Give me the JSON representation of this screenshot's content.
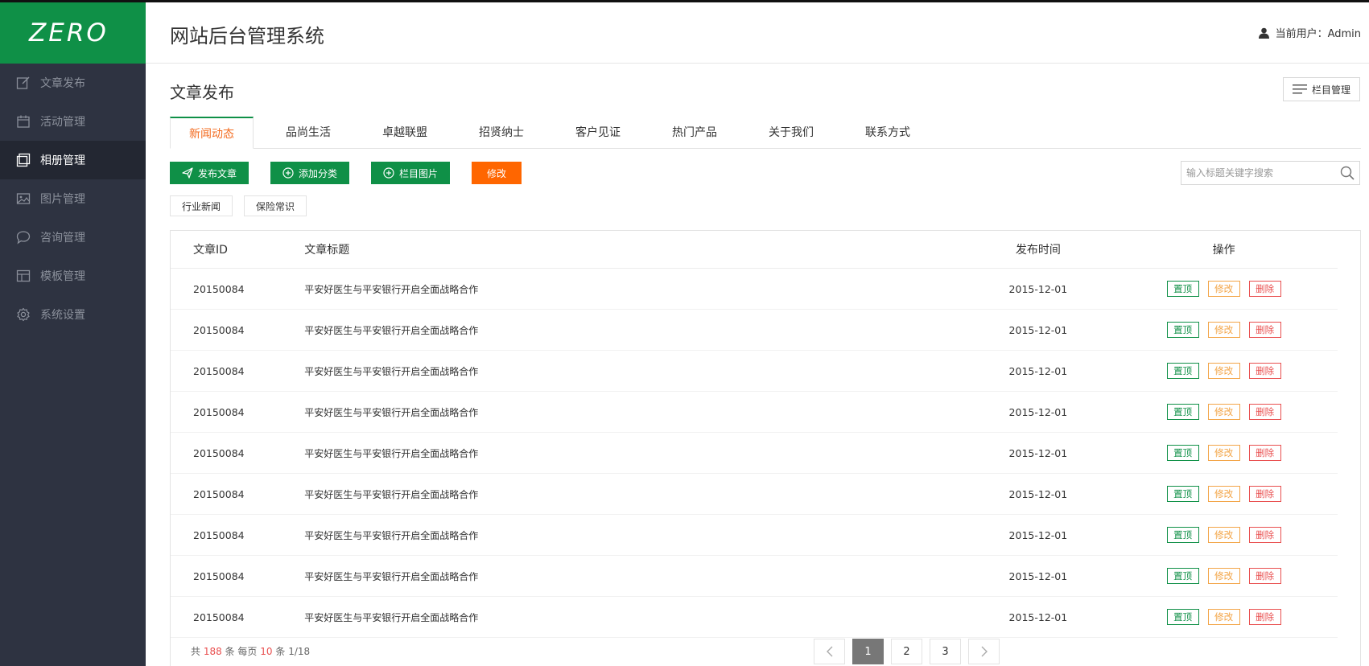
{
  "app": {
    "logo": "ZERO",
    "title": "网站后台管理系统"
  },
  "user": {
    "label": "当前用户：Admin"
  },
  "sidebar": {
    "items": [
      {
        "label": "文章发布",
        "icon": "edit-icon"
      },
      {
        "label": "活动管理",
        "icon": "calendar-icon"
      },
      {
        "label": "相册管理",
        "icon": "album-icon",
        "active": true
      },
      {
        "label": "图片管理",
        "icon": "image-icon"
      },
      {
        "label": "咨询管理",
        "icon": "chat-icon"
      },
      {
        "label": "模板管理",
        "icon": "template-icon"
      },
      {
        "label": "系统设置",
        "icon": "gear-icon"
      }
    ]
  },
  "page": {
    "title": "文章发布",
    "column_manage": "栏目管理"
  },
  "tabs": [
    "新闻动态",
    "品尚生活",
    "卓越联盟",
    "招贤纳士",
    "客户见证",
    "热门产品",
    "关于我们",
    "联系方式"
  ],
  "toolbar": {
    "publish": "发布文章",
    "add_category": "添加分类",
    "column_image": "栏目图片",
    "edit": "修改"
  },
  "search": {
    "placeholder": "输入标题关键字搜索"
  },
  "subcategories": [
    "行业新闻",
    "保险常识"
  ],
  "table": {
    "headers": {
      "id": "文章ID",
      "title": "文章标题",
      "time": "发布时间",
      "ops": "操作"
    },
    "ops": {
      "top": "置顶",
      "edit": "修改",
      "delete": "删除"
    },
    "rows": [
      {
        "id": "20150084",
        "title": "平安好医生与平安银行开启全面战略合作",
        "time": "2015-12-01"
      },
      {
        "id": "20150084",
        "title": "平安好医生与平安银行开启全面战略合作",
        "time": "2015-12-01"
      },
      {
        "id": "20150084",
        "title": "平安好医生与平安银行开启全面战略合作",
        "time": "2015-12-01"
      },
      {
        "id": "20150084",
        "title": "平安好医生与平安银行开启全面战略合作",
        "time": "2015-12-01"
      },
      {
        "id": "20150084",
        "title": "平安好医生与平安银行开启全面战略合作",
        "time": "2015-12-01"
      },
      {
        "id": "20150084",
        "title": "平安好医生与平安银行开启全面战略合作",
        "time": "2015-12-01"
      },
      {
        "id": "20150084",
        "title": "平安好医生与平安银行开启全面战略合作",
        "time": "2015-12-01"
      },
      {
        "id": "20150084",
        "title": "平安好医生与平安银行开启全面战略合作",
        "time": "2015-12-01"
      },
      {
        "id": "20150084",
        "title": "平安好医生与平安银行开启全面战略合作",
        "time": "2015-12-01"
      }
    ]
  },
  "pagination": {
    "total_prefix": "共",
    "total": "188",
    "total_suffix": "条 每页",
    "per_page": "10",
    "per_page_suffix": "条",
    "current_of": "1/18",
    "pages": [
      "1",
      "2",
      "3"
    ],
    "active_page": "1"
  },
  "colors": {
    "brand_green": "#0f9047",
    "accent_orange": "#ff6600",
    "sidebar_bg": "#2e3341",
    "danger": "#e94f4f",
    "warn": "#f3a548"
  }
}
